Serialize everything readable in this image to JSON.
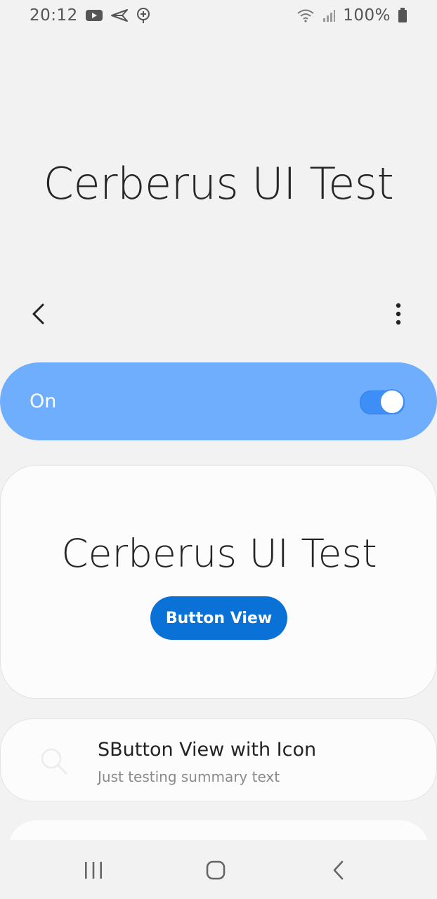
{
  "status_bar": {
    "time": "20:12",
    "battery": "100%",
    "left_icons": [
      "youtube-icon",
      "send-icon",
      "location-pin-icon"
    ],
    "right_icons": [
      "wifi-icon",
      "signal-icon",
      "battery-icon"
    ]
  },
  "header": {
    "title": "Cerberus UI Test",
    "back_icon": "back-arrow-icon",
    "more_icon": "more-vertical-icon"
  },
  "master_switch": {
    "label": "On",
    "state": "on",
    "bar_color": "#6eaefd",
    "toggle_color": "#3e8ef7"
  },
  "card": {
    "title": "Cerberus UI Test",
    "button_label": "Button View",
    "button_color": "#0a72d6"
  },
  "list_items": [
    {
      "icon": "search-icon",
      "title": "SButton View with Icon",
      "summary": "Just testing summary text"
    }
  ],
  "nav_bar": {
    "buttons": [
      "recents-icon",
      "home-icon",
      "back-icon"
    ]
  }
}
